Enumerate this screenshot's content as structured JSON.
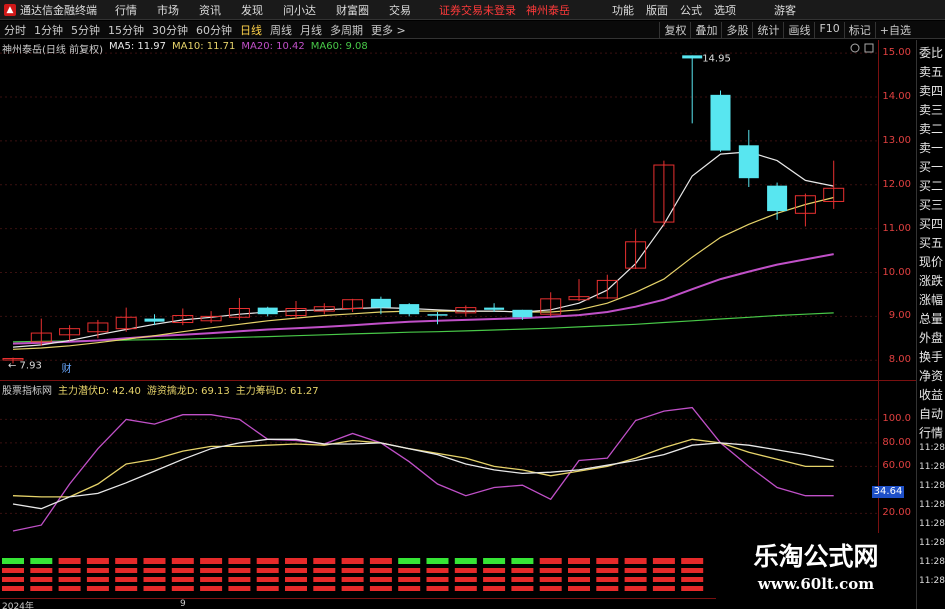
{
  "menubar": {
    "app_title": "通达信金融终端",
    "items": [
      "行情",
      "市场",
      "资讯",
      "发现",
      "问小达",
      "财富圈",
      "交易"
    ],
    "login_status": "证券交易未登录",
    "stock_name": "神州泰岳",
    "right_items": [
      "功能",
      "版面",
      "公式",
      "选项",
      "游客"
    ]
  },
  "periodbar": {
    "periods": [
      "分时",
      "1分钟",
      "5分钟",
      "15分钟",
      "30分钟",
      "60分钟",
      "日线",
      "周线",
      "月线",
      "多周期",
      "更多 >"
    ],
    "active_period": "日线",
    "tools": [
      "复权",
      "叠加",
      "多股",
      "统计",
      "画线",
      "F10",
      "标记",
      "+自选"
    ]
  },
  "main_legend": {
    "title": "神州泰岳(日线 前复权)",
    "ma5": "MA5: 11.97",
    "ma10": "MA10: 11.71",
    "ma20": "MA20: 10.42",
    "ma60": "MA60: 9.08"
  },
  "colors": {
    "up": "#e83030",
    "down": "#58e6f0",
    "ma5": "#e8e8e8",
    "ma10": "#e6d36a",
    "ma20": "#c050c8",
    "ma60": "#48c848",
    "axis": "#e04040",
    "active": "#ffd24a",
    "ind_purple": "#c050c8",
    "ind_yellow": "#e6d36a",
    "ind_white": "#e8e8e8",
    "bar_green": "#36e636",
    "bar_red": "#e62a2a"
  },
  "price_axis": [
    "15.00",
    "14.00",
    "13.00",
    "12.00",
    "11.00",
    "10.00",
    "9.00",
    "8.00"
  ],
  "annotations": {
    "high": "14.95",
    "low": "7.93",
    "marker": "财"
  },
  "candles": [
    {
      "o": 8.04,
      "c": 8.04,
      "h": 8.06,
      "l": 7.93
    },
    {
      "o": 8.42,
      "c": 8.62,
      "h": 8.95,
      "l": 8.33
    },
    {
      "o": 8.58,
      "c": 8.72,
      "h": 8.8,
      "l": 8.45
    },
    {
      "o": 8.65,
      "c": 8.85,
      "h": 8.92,
      "l": 8.5
    },
    {
      "o": 8.72,
      "c": 8.98,
      "h": 9.2,
      "l": 8.65
    },
    {
      "o": 8.95,
      "c": 8.88,
      "h": 9.05,
      "l": 8.8
    },
    {
      "o": 8.86,
      "c": 9.02,
      "h": 9.18,
      "l": 8.8
    },
    {
      "o": 8.9,
      "c": 9.0,
      "h": 9.12,
      "l": 8.85
    },
    {
      "o": 8.98,
      "c": 9.18,
      "h": 9.42,
      "l": 8.92
    },
    {
      "o": 9.2,
      "c": 9.05,
      "h": 9.22,
      "l": 9.0
    },
    {
      "o": 9.02,
      "c": 9.18,
      "h": 9.35,
      "l": 8.95
    },
    {
      "o": 9.12,
      "c": 9.22,
      "h": 9.3,
      "l": 9.05
    },
    {
      "o": 9.18,
      "c": 9.38,
      "h": 9.4,
      "l": 9.1
    },
    {
      "o": 9.4,
      "c": 9.2,
      "h": 9.45,
      "l": 9.05
    },
    {
      "o": 9.28,
      "c": 9.05,
      "h": 9.3,
      "l": 9.0
    },
    {
      "o": 9.05,
      "c": 9.02,
      "h": 9.1,
      "l": 8.82
    },
    {
      "o": 9.08,
      "c": 9.2,
      "h": 9.25,
      "l": 9.0
    },
    {
      "o": 9.2,
      "c": 9.15,
      "h": 9.3,
      "l": 9.1
    },
    {
      "o": 9.15,
      "c": 8.98,
      "h": 9.15,
      "l": 8.92
    },
    {
      "o": 9.05,
      "c": 9.4,
      "h": 9.55,
      "l": 9.0
    },
    {
      "o": 9.38,
      "c": 9.45,
      "h": 9.85,
      "l": 9.35
    },
    {
      "o": 9.42,
      "c": 9.82,
      "h": 9.95,
      "l": 9.4
    },
    {
      "o": 10.1,
      "c": 10.7,
      "h": 10.98,
      "l": 10.08
    },
    {
      "o": 11.15,
      "c": 12.45,
      "h": 12.55,
      "l": 11.05
    },
    {
      "o": 14.95,
      "c": 14.88,
      "h": 14.95,
      "l": 13.4
    },
    {
      "o": 14.05,
      "c": 12.78,
      "h": 14.15,
      "l": 12.75
    },
    {
      "o": 12.9,
      "c": 12.15,
      "h": 13.25,
      "l": 11.95
    },
    {
      "o": 11.98,
      "c": 11.4,
      "h": 12.05,
      "l": 11.2
    },
    {
      "o": 11.35,
      "c": 11.75,
      "h": 11.8,
      "l": 11.05
    },
    {
      "o": 11.62,
      "c": 11.92,
      "h": 12.55,
      "l": 11.45
    }
  ],
  "ma5": [
    8.3,
    8.35,
    8.45,
    8.58,
    8.7,
    8.82,
    8.92,
    8.98,
    9.05,
    9.1,
    9.13,
    9.15,
    9.18,
    9.2,
    9.18,
    9.15,
    9.12,
    9.12,
    9.1,
    9.15,
    9.3,
    9.6,
    10.2,
    11.1,
    12.2,
    12.7,
    12.75,
    12.55,
    12.1,
    11.97
  ],
  "ma10": [
    8.25,
    8.28,
    8.33,
    8.4,
    8.48,
    8.56,
    8.65,
    8.74,
    8.82,
    8.9,
    8.96,
    9.02,
    9.06,
    9.1,
    9.12,
    9.12,
    9.12,
    9.12,
    9.1,
    9.1,
    9.15,
    9.3,
    9.55,
    9.85,
    10.35,
    10.8,
    11.1,
    11.35,
    11.55,
    11.71
  ],
  "ma20": [
    8.38,
    8.4,
    8.42,
    8.45,
    8.5,
    8.55,
    8.58,
    8.62,
    8.66,
    8.7,
    8.73,
    8.76,
    8.8,
    8.84,
    8.88,
    8.9,
    8.92,
    8.94,
    8.96,
    8.99,
    9.03,
    9.1,
    9.22,
    9.38,
    9.62,
    9.85,
    10.02,
    10.18,
    10.3,
    10.42
  ],
  "ma60": [
    8.42,
    8.43,
    8.44,
    8.45,
    8.46,
    8.47,
    8.48,
    8.5,
    8.52,
    8.54,
    8.56,
    8.58,
    8.6,
    8.62,
    8.64,
    8.65,
    8.67,
    8.69,
    8.71,
    8.73,
    8.76,
    8.79,
    8.82,
    8.86,
    8.9,
    8.94,
    8.98,
    9.02,
    9.05,
    9.08
  ],
  "indicator": {
    "title": "股票指标网",
    "line1": "主力潜伏D: 42.40",
    "line2": "游资擒龙D: 69.13",
    "line3": "主力筹码D: 61.27",
    "axis": [
      "100.0",
      "80.00",
      "60.00",
      "20.00"
    ],
    "current": "34.64",
    "purple": [
      5,
      10,
      45,
      75,
      100,
      96,
      104,
      104,
      100,
      83,
      82,
      79,
      88,
      80,
      64,
      45,
      35,
      42,
      44,
      32,
      65,
      67,
      99,
      107,
      110,
      80,
      60,
      42,
      35,
      35
    ],
    "yellow": [
      35,
      34,
      34,
      45,
      62,
      66,
      73,
      77,
      77,
      78,
      79,
      78,
      82,
      80,
      75,
      71,
      67,
      60,
      57,
      52,
      56,
      60,
      67,
      76,
      83,
      80,
      72,
      66,
      60,
      60
    ],
    "white": [
      28,
      24,
      34,
      37,
      46,
      56,
      66,
      75,
      80,
      83,
      83,
      79,
      79,
      80,
      75,
      70,
      62,
      57,
      54,
      55,
      57,
      61,
      65,
      70,
      78,
      80,
      78,
      74,
      70,
      65
    ],
    "bars": [
      "g",
      "g",
      "r",
      "r",
      "r",
      "r",
      "r",
      "r",
      "r",
      "r",
      "r",
      "r",
      "r",
      "r",
      "g",
      "g",
      "g",
      "g",
      "g",
      "r",
      "r",
      "r",
      "r",
      "r",
      "r"
    ]
  },
  "side_panel": [
    "委比",
    "卖五",
    "卖四",
    "卖三",
    "卖二",
    "卖一",
    "买一",
    "买二",
    "买三",
    "买四",
    "买五",
    "现价",
    "涨跌",
    "涨幅",
    "总量",
    "外盘",
    "换手",
    "净资",
    "收益",
    "自动",
    "行情",
    "11:28",
    "11:28",
    "11:28",
    "11:28",
    "11:28",
    "11:28",
    "11:28",
    "11:28"
  ],
  "date_axis": {
    "year_label": "2024年",
    "month_label": "9"
  },
  "watermark": {
    "title": "乐淘公式网",
    "url": "www.60lt.com"
  }
}
